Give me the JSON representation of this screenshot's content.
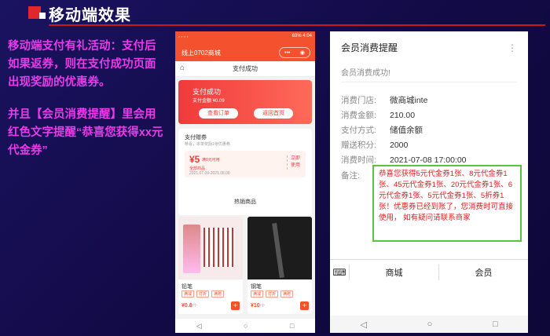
{
  "slide": {
    "title": "移动端效果",
    "paragraph_1": "移动端支付有礼活动：支付后如果返券，则在支付成功页面出现奖励的优惠券。",
    "paragraph_2": "并且【会员消费提醒】里会用红色文字提醒“恭喜您获得xx元代金券”"
  },
  "phone1": {
    "status_left": "ꞏ ꞏ ꞏ ꞏ",
    "status_right": "69% 4:04",
    "shop_name": "线上0702商城",
    "capsule_more": "•••",
    "capsule_close": "◉",
    "nav_title": "支付成功",
    "success_title": "支付成功",
    "amount": "支付金额 ¥0.09",
    "view_order_button": "查看订单",
    "back_home_button": "返回首页",
    "gift_title": "支付赠券",
    "gift_subtitle": "恭喜，本单奖励1张优惠券",
    "coupon_value": "¥5",
    "coupon_name": "满0元可用",
    "coupon_scope": "全部商品",
    "coupon_date": "2021.07.09-2021.08.08",
    "coupon_use": "立即使用",
    "hot_goods_title": "热销商品",
    "goods": [
      {
        "name": "铅笔",
        "tags": [
          "满减",
          "打折",
          "满赠"
        ],
        "price": "¥0.8",
        "unit": "/个"
      },
      {
        "name": "钢笔",
        "tags": [
          "满减",
          "打折",
          "满赠"
        ],
        "price": "¥10",
        "unit": "/个"
      }
    ],
    "plus_label": "+"
  },
  "phone2": {
    "title": "会员消费提醒",
    "menu_icon": "⋮",
    "success_text": "会员消费成功!",
    "rows": [
      {
        "label": "消费门店:",
        "value": "微商城inte"
      },
      {
        "label": "消费金额:",
        "value": "210.00"
      },
      {
        "label": "支付方式:",
        "value": "储值余额"
      },
      {
        "label": "赠送积分:",
        "value": "2000"
      },
      {
        "label": "消费时间:",
        "value": "2021-07-08 17:00:00"
      }
    ],
    "note_label": "备注:",
    "note_text": "恭喜您获得5元代金券1张、8元代金券1张、45元代金券1张、20元代金券1张、6元代金券1张、5元代金券1张、5折券1张！优惠券已经到账了，您消费时可直接使用， 如有疑问请联系商家",
    "tab_mall": "商城",
    "tab_member": "会员",
    "keyboard_icon": "⌨"
  },
  "system_nav": {
    "back": "◁",
    "home": "○",
    "recent": "□"
  },
  "colors": {
    "slide_bg": "#150d4e",
    "accent_red": "#e0272b",
    "magenta_text": "#e93bea",
    "phone_orange": "#f4522e",
    "note_red": "#e02020",
    "note_border": "#5cc243"
  }
}
